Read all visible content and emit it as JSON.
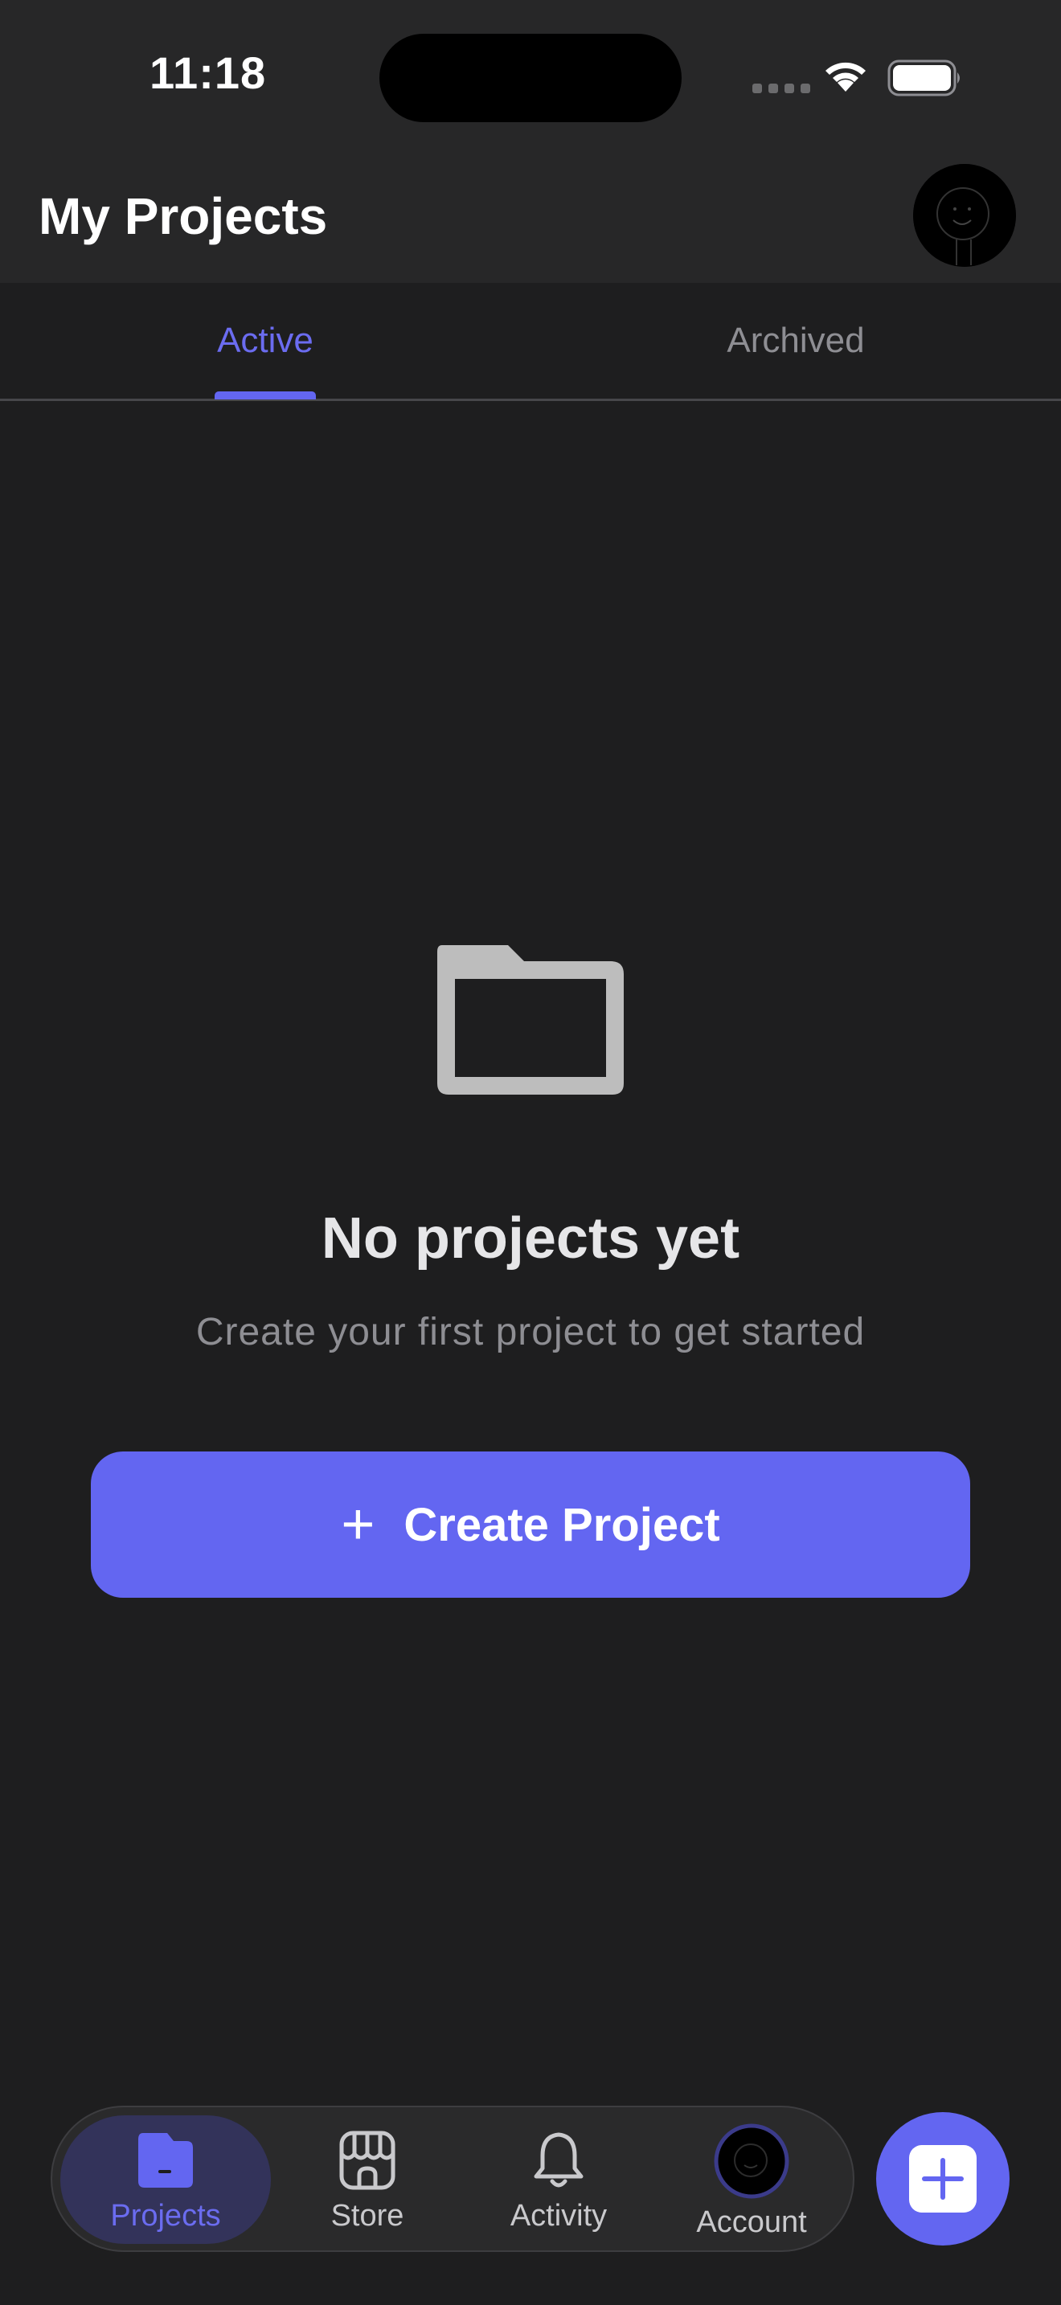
{
  "status_bar": {
    "time": "11:18"
  },
  "header": {
    "title": "My Projects",
    "avatar_icon": "avatar-icon"
  },
  "tabs": [
    {
      "label": "Active",
      "active": true
    },
    {
      "label": "Archived",
      "active": false
    }
  ],
  "empty_state": {
    "icon": "folder-icon",
    "title": "No projects yet",
    "subtitle": "Create your first project to get started",
    "button_label": "Create Project",
    "button_icon": "plus-icon"
  },
  "tab_bar": {
    "items": [
      {
        "label": "Projects",
        "icon": "projects-folder-icon",
        "active": true
      },
      {
        "label": "Store",
        "icon": "store-icon",
        "active": false
      },
      {
        "label": "Activity",
        "icon": "bell-icon",
        "active": false
      },
      {
        "label": "Account",
        "icon": "avatar-icon",
        "active": false
      }
    ],
    "fab_icon": "plus-square-icon"
  },
  "colors": {
    "accent": "#6366f1",
    "background": "#1e1e1f",
    "header_background": "#272728",
    "muted_text": "#8e8e93"
  }
}
